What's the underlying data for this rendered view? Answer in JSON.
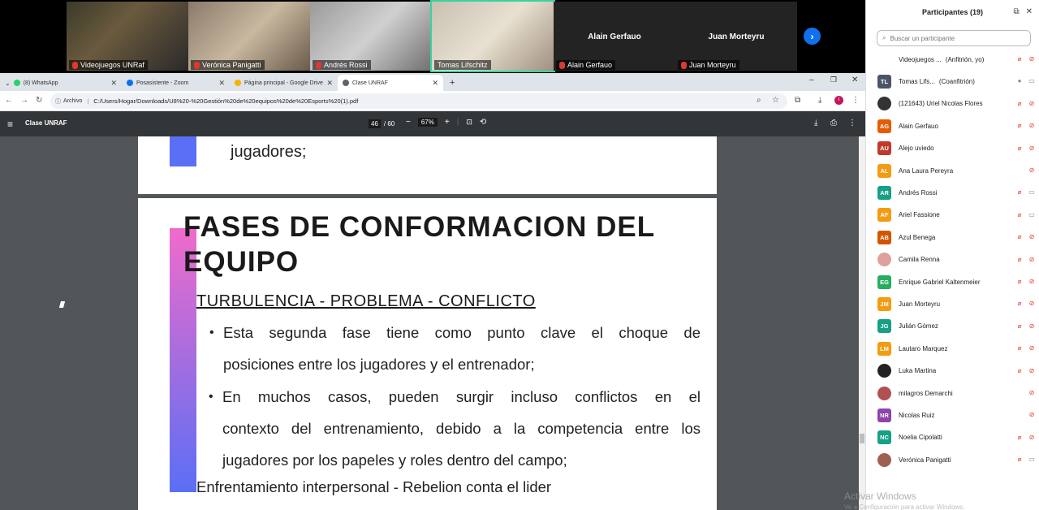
{
  "zoom": {
    "tiles": [
      {
        "name": "Videojuegos UNRaf",
        "muted": true
      },
      {
        "name": "Verónica Panigatti",
        "muted": true
      },
      {
        "name": "Andrés Rossi",
        "muted": true
      },
      {
        "name": "Tomas Lifschitz",
        "muted": false
      },
      {
        "name": "Alain Gerfauo",
        "muted": true,
        "big_name": "Alain Gerfauo"
      },
      {
        "name": "Juan Morteyru",
        "muted": true,
        "big_name": "Juan Morteyru"
      }
    ],
    "next_icon": "chevron-right-icon"
  },
  "browser": {
    "tabs": [
      {
        "label": "(8) WhatsApp",
        "color": "#25d366"
      },
      {
        "label": "Posasistente - Zoom",
        "color": "#0e72ed"
      },
      {
        "label": "Página principal - Google Drive",
        "color": "#f4b400"
      },
      {
        "label": "Clase UNRAF",
        "color": "#5f6368"
      }
    ],
    "new_tab": "+",
    "file_chip": "Archivo",
    "url": "C:/Users/Hogar/Downloads/U8%20-%20Gestión%20de%20equipos%20de%20Esports%20(1).pdf"
  },
  "pdf": {
    "title": "Clase UNRAF",
    "page_current": "46",
    "page_total": "/ 60",
    "zoom": "67%",
    "minus": "−",
    "plus": "+",
    "page1_text": "jugadores;",
    "heading_line1": "FASES DE CONFORMACION DEL",
    "heading_line2": "EQUIPO",
    "subtitle": "TURBULENCIA - PROBLEMA - CONFLICTO",
    "bullet1_line1": "Esta segunda fase tiene como punto clave el choque de",
    "bullet1_line2": "posiciones entre los jugadores y el entrenador;",
    "bullet2_line1": "En muchos casos, pueden surgir incluso conflictos en el",
    "bullet2_line2": "contexto del entrenamiento, debido a la competencia entre los",
    "bullet2_line3": "jugadores por los papeles y roles dentro del campo;",
    "bottom_line": "Enfrentamiento interpersonal - Rebelion conta el lider",
    "bullet_char": "•"
  },
  "panel": {
    "title": "Participantes (19)",
    "search_placeholder": "Buscar un participante",
    "participants": [
      {
        "initials": "",
        "name": "Videojuegos ...",
        "role": "(Anfitrión, yo)",
        "color": "#ffffff",
        "mic": "off",
        "cam": "off"
      },
      {
        "initials": "TL",
        "name": "Tomas Lifs...",
        "role": "(Coanfitrión)",
        "color": "#4a5568",
        "mic": "on",
        "cam": "on"
      },
      {
        "initials": "",
        "name": "(121643) Uriel Nicolas Flores",
        "role": "",
        "color": "#333333",
        "mic": "off",
        "cam": "off"
      },
      {
        "initials": "AG",
        "name": "Alain Gerfauo",
        "role": "",
        "color": "#e65c00",
        "mic": "off",
        "cam": "off"
      },
      {
        "initials": "AU",
        "name": "Alejo uviedo",
        "role": "",
        "color": "#c0392b",
        "mic": "off",
        "cam": "off"
      },
      {
        "initials": "AL",
        "name": "Ana Laura Pereyra",
        "role": "",
        "color": "#f39c12",
        "mic": "",
        "cam": "off"
      },
      {
        "initials": "AR",
        "name": "Andrés Rossi",
        "role": "",
        "color": "#16a085",
        "mic": "off",
        "cam": "on"
      },
      {
        "initials": "AF",
        "name": "Ariel Fassione",
        "role": "",
        "color": "#f39c12",
        "mic": "off",
        "cam": "on"
      },
      {
        "initials": "AB",
        "name": "Azul Benega",
        "role": "",
        "color": "#d35400",
        "mic": "off",
        "cam": "off"
      },
      {
        "initials": "",
        "name": "Camila Renna",
        "role": "",
        "color": "#e0a0a0",
        "mic": "off",
        "cam": "off"
      },
      {
        "initials": "EG",
        "name": "Enrique Gabriel Kaltenmeier",
        "role": "",
        "color": "#27ae60",
        "mic": "off",
        "cam": "off"
      },
      {
        "initials": "JM",
        "name": "Juan Morteyru",
        "role": "",
        "color": "#f39c12",
        "mic": "off",
        "cam": "off"
      },
      {
        "initials": "JG",
        "name": "Julián Gómez",
        "role": "",
        "color": "#16a085",
        "mic": "off",
        "cam": "off"
      },
      {
        "initials": "LM",
        "name": "Lautaro Marquez",
        "role": "",
        "color": "#f39c12",
        "mic": "off",
        "cam": "off"
      },
      {
        "initials": "",
        "name": "Luka Martina",
        "role": "",
        "color": "#222222",
        "mic": "off",
        "cam": "off"
      },
      {
        "initials": "",
        "name": "milagros Demarchi",
        "role": "",
        "color": "#b05050",
        "mic": "",
        "cam": "off"
      },
      {
        "initials": "NR",
        "name": "Nicolas Ruiz",
        "role": "",
        "color": "#8e44ad",
        "mic": "",
        "cam": "off"
      },
      {
        "initials": "NC",
        "name": "Noelia Cipolatti",
        "role": "",
        "color": "#16a085",
        "mic": "off",
        "cam": "off"
      },
      {
        "initials": "",
        "name": "Verónica Panigatti",
        "role": "",
        "color": "#a06050",
        "mic": "off",
        "cam": "on"
      }
    ]
  },
  "windows": {
    "activate_title": "Activar Windows",
    "activate_sub": "Ve a Configuración para activar Windows."
  }
}
